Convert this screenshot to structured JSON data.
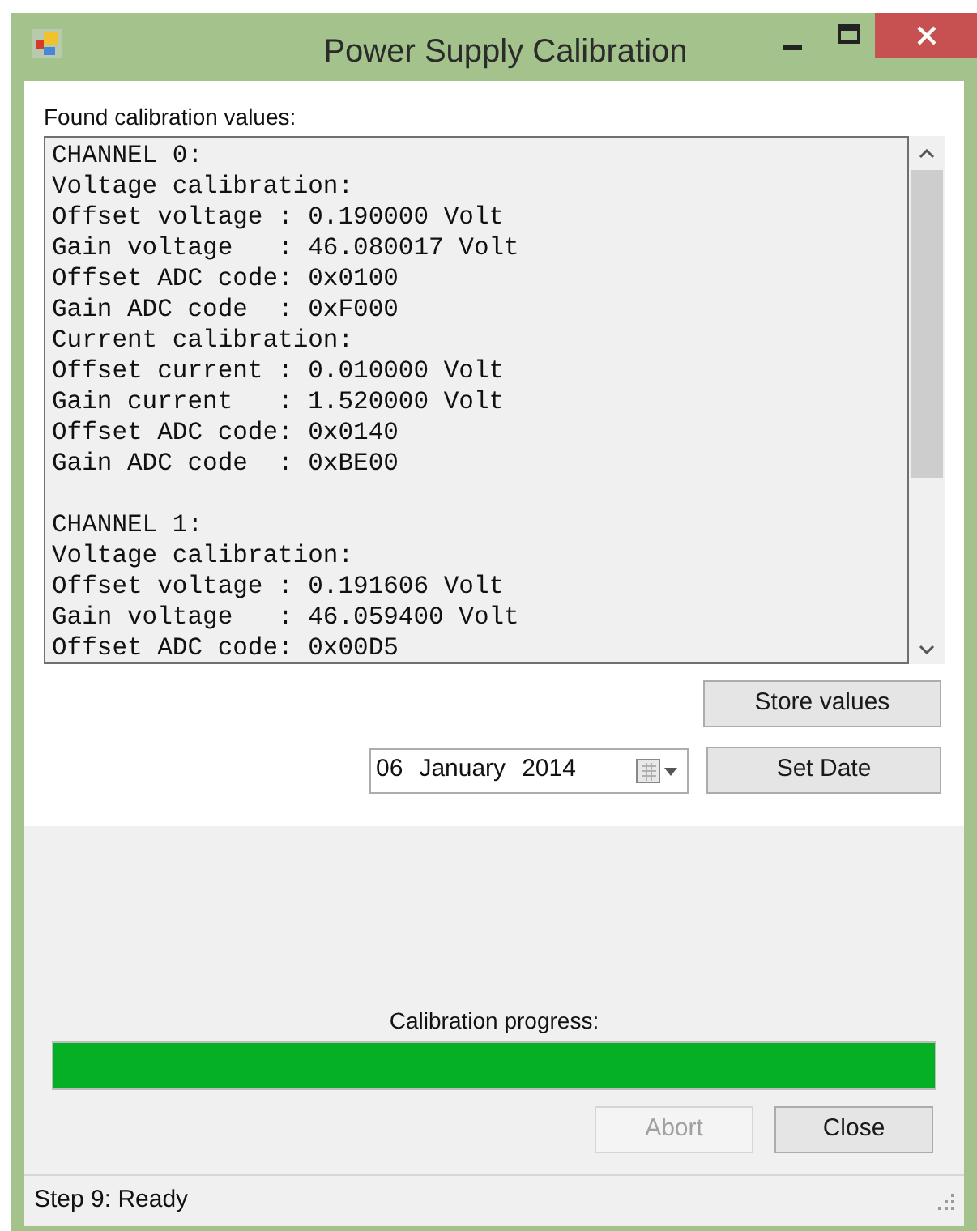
{
  "window": {
    "title": "Power Supply Calibration"
  },
  "results": {
    "label": "Found calibration values:",
    "blocks": [
      [
        "CHANNEL 0:",
        "Voltage calibration:",
        "Offset voltage : 0.190000 Volt",
        "Gain voltage   : 46.080017 Volt",
        "Offset ADC code: 0x0100",
        "Gain ADC code  : 0xF000",
        "Current calibration:",
        "Offset current : 0.010000 Volt",
        "Gain current   : 1.520000 Volt",
        "Offset ADC code: 0x0140",
        "Gain ADC code  : 0xBE00"
      ],
      [
        "CHANNEL 1:",
        "Voltage calibration:",
        "Offset voltage : 0.191606 Volt",
        "Gain voltage   : 46.059400 Volt",
        "Offset ADC code: 0x00D5"
      ]
    ]
  },
  "store_button": {
    "label": "Store values",
    "disabled": false
  },
  "date_picker": {
    "day": "06",
    "month": "January",
    "year": "2014"
  },
  "set_date_button": {
    "label": "Set Date",
    "disabled": false
  },
  "progress": {
    "label": "Calibration progress:",
    "level": 1
  },
  "buttons": [
    {
      "label": "Abort",
      "disabled": true
    },
    {
      "label": "Close",
      "disabled": false
    }
  ],
  "status_bar": {
    "text": "Step 9: Ready"
  }
}
